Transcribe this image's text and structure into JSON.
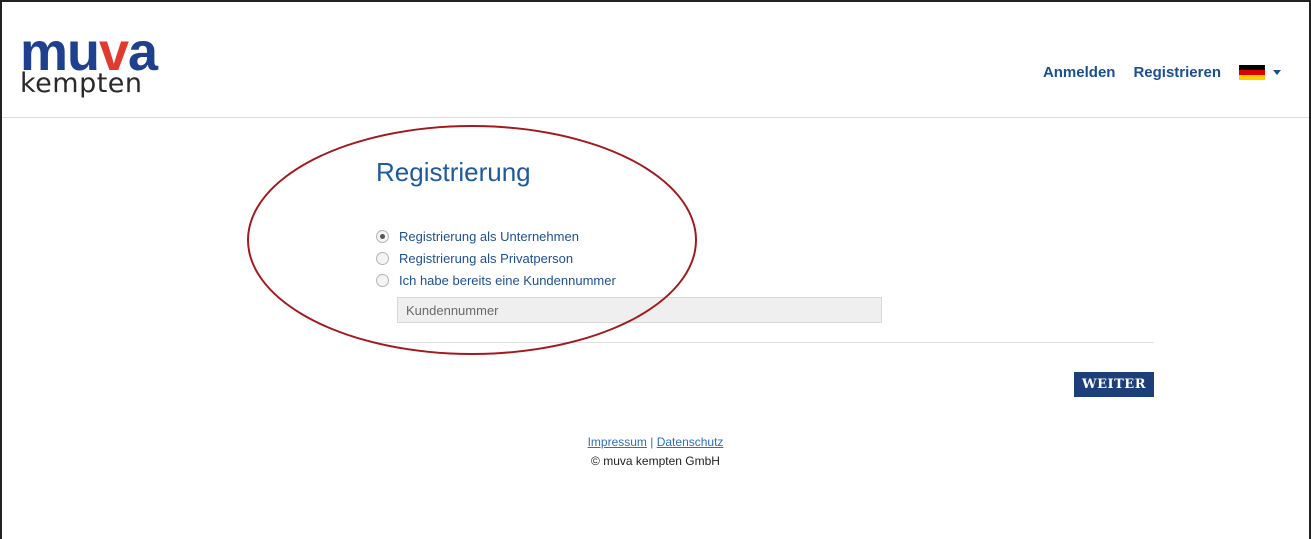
{
  "header": {
    "logo_top_part1": "mu",
    "logo_top_part2": "v",
    "logo_top_part3": "a",
    "logo_bottom": "kempten",
    "nav": {
      "login": "Anmelden",
      "register": "Registrieren"
    },
    "language": {
      "flag": "de-flag-icon",
      "colors": [
        "#000000",
        "#dd0000",
        "#ffce00"
      ]
    }
  },
  "form": {
    "title": "Registrierung",
    "options": [
      {
        "label": "Registrierung als Unternehmen",
        "checked": true
      },
      {
        "label": "Registrierung als Privatperson",
        "checked": false
      },
      {
        "label": "Ich habe bereits eine Kundennummer",
        "checked": false
      }
    ],
    "customer_number_placeholder": "Kundennummer",
    "submit_label": "WEITER"
  },
  "footer": {
    "impressum": "Impressum",
    "separator": "|",
    "privacy": "Datenschutz",
    "copyright": "© muva kempten GmbH"
  },
  "colors": {
    "accent": "#1c3f7a",
    "annotation": "#a3191d",
    "logo_red": "#e23a2e",
    "logo_blue": "#1f3f8f"
  }
}
